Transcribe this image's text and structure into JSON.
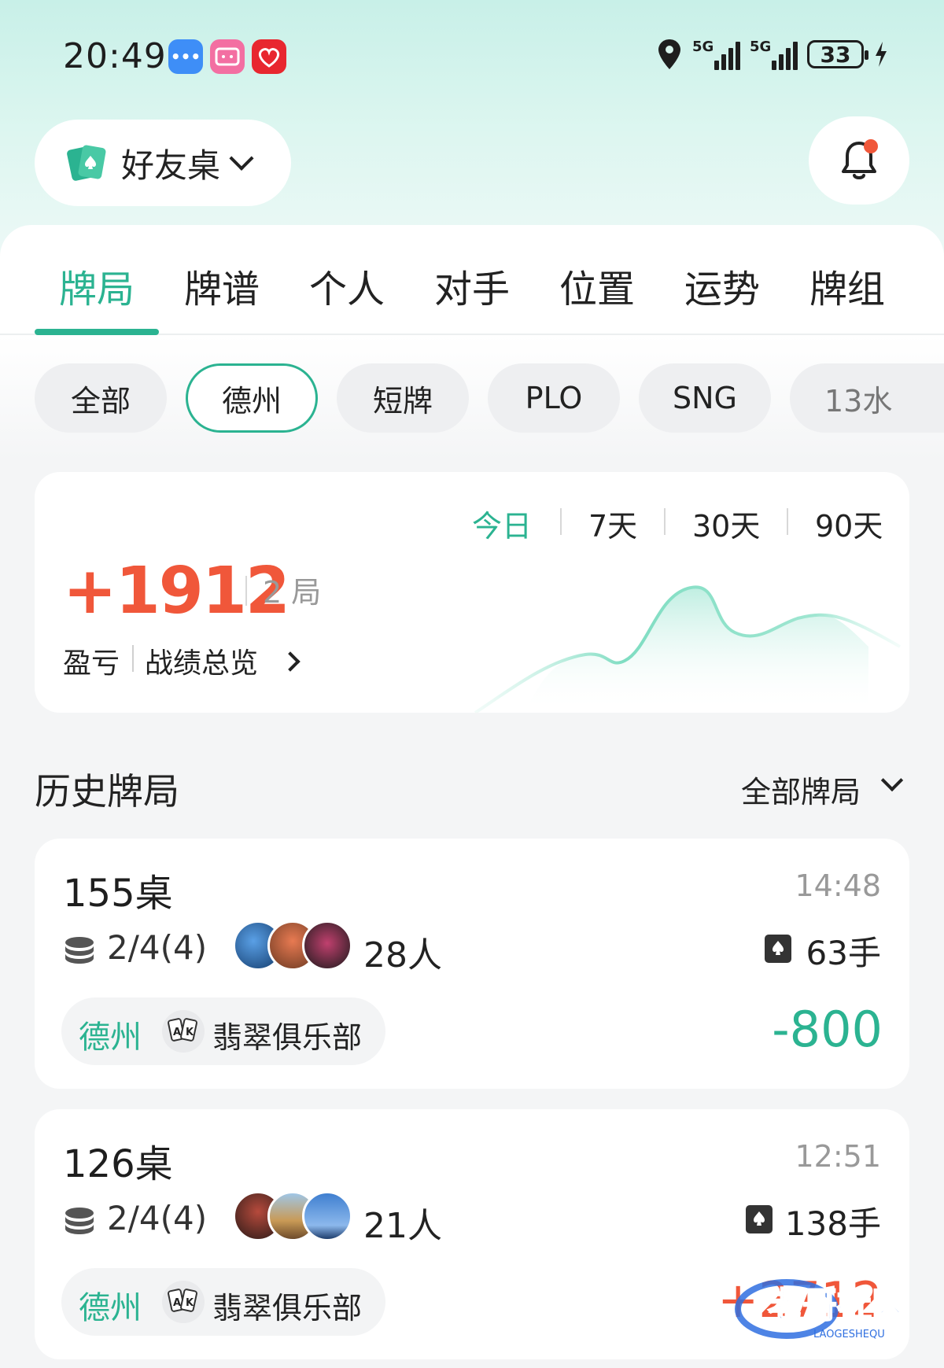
{
  "status_bar": {
    "time": "20:49",
    "net1": "5G",
    "net2": "5G",
    "battery": "33"
  },
  "header": {
    "table_selector": "好友桌",
    "icons": [
      "cards-logo-icon",
      "chevron-down-icon",
      "bell-icon"
    ]
  },
  "tabs": [
    "牌局",
    "牌谱",
    "个人",
    "对手",
    "位置",
    "运势",
    "牌组"
  ],
  "active_tab": "牌局",
  "filters": [
    "全部",
    "德州",
    "短牌",
    "PLO",
    "SNG",
    "13水"
  ],
  "active_filter": "德州",
  "summary": {
    "periods": [
      "今日",
      "7天",
      "30天",
      "90天"
    ],
    "active_period": "今日",
    "profit": "+1912",
    "rounds": "2 局",
    "pnl_label": "盈亏",
    "overview_label": "战绩总览"
  },
  "history": {
    "title": "历史牌局",
    "filter_label": "全部牌局",
    "games": [
      {
        "name": "155桌",
        "time": "14:48",
        "blinds": "2/4(4)",
        "players": "28人",
        "hands": "63手",
        "type": "德州",
        "club": "翡翠俱乐部",
        "result": "-800"
      },
      {
        "name": "126桌",
        "time": "12:51",
        "blinds": "2/4(4)",
        "players": "21人",
        "hands": "138手",
        "type": "德州",
        "club": "翡翠俱乐部",
        "result": "+2712"
      }
    ]
  },
  "watermark": {
    "title": "老哥社区",
    "sub": "LAOGESHEQU"
  },
  "colors": {
    "accent": "#2bb391",
    "profit": "#f0573a",
    "loss": "#2bb391"
  }
}
